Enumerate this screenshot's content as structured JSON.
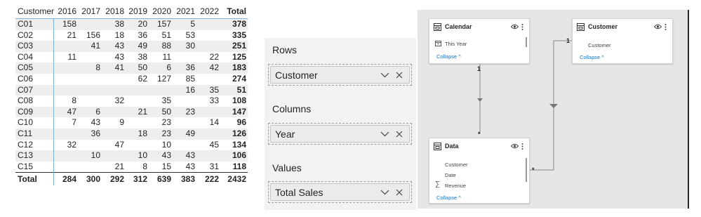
{
  "matrix": {
    "headers": [
      "Customer",
      "2016",
      "2017",
      "2018",
      "2019",
      "2020",
      "2021",
      "2022",
      "Total"
    ],
    "rows": [
      [
        "C01",
        "158",
        "",
        "38",
        "20",
        "157",
        "5",
        "",
        "378"
      ],
      [
        "C02",
        "21",
        "156",
        "18",
        "36",
        "51",
        "53",
        "",
        "335"
      ],
      [
        "C03",
        "",
        "41",
        "43",
        "49",
        "88",
        "30",
        "",
        "251"
      ],
      [
        "C04",
        "11",
        "",
        "43",
        "38",
        "11",
        "",
        "22",
        "125"
      ],
      [
        "C05",
        "",
        "8",
        "41",
        "50",
        "6",
        "36",
        "42",
        "183"
      ],
      [
        "C06",
        "",
        "",
        "",
        "62",
        "127",
        "85",
        "",
        "274"
      ],
      [
        "C07",
        "",
        "",
        "",
        "",
        "",
        "16",
        "35",
        "51"
      ],
      [
        "C08",
        "8",
        "",
        "32",
        "",
        "35",
        "",
        "33",
        "108"
      ],
      [
        "C09",
        "47",
        "6",
        "",
        "21",
        "50",
        "23",
        "",
        "147"
      ],
      [
        "C10",
        "7",
        "43",
        "9",
        "",
        "23",
        "",
        "14",
        "96"
      ],
      [
        "C11",
        "",
        "36",
        "",
        "18",
        "23",
        "49",
        "",
        "126"
      ],
      [
        "C12",
        "32",
        "",
        "47",
        "",
        "10",
        "",
        "45",
        "134"
      ],
      [
        "C13",
        "",
        "10",
        "",
        "10",
        "43",
        "43",
        "",
        "106"
      ],
      [
        "C15",
        "",
        "",
        "21",
        "8",
        "15",
        "43",
        "31",
        "118"
      ]
    ],
    "total_row": [
      "Total",
      "284",
      "300",
      "292",
      "312",
      "639",
      "383",
      "222",
      "2432"
    ]
  },
  "field_wells": {
    "rows_title": "Rows",
    "rows_field": "Customer",
    "columns_title": "Columns",
    "columns_field": "Year",
    "values_title": "Values",
    "values_field": "Total Sales"
  },
  "model": {
    "calendar": {
      "title": "Calendar",
      "fields": [
        "This Year"
      ],
      "collapse": "Collapse ^"
    },
    "customer": {
      "title": "Customer",
      "fields": [
        "Customer"
      ],
      "collapse": "Collapse ^"
    },
    "data": {
      "title": "Data",
      "fields": [
        "Customer",
        "Date",
        "Revenue"
      ],
      "collapse": "Collapse ^"
    },
    "relationships": [
      {
        "from": "Calendar",
        "to": "Data",
        "from_card": "1",
        "to_card": "*"
      },
      {
        "from": "Customer",
        "to": "Data",
        "from_card": "1",
        "to_card": "*"
      }
    ]
  },
  "colors": {
    "matrix_separator": "#7fb0d8",
    "row_band": "#eeeeee",
    "link": "#1a73c8",
    "model_background": "#e6e6e6",
    "wells_background": "#f3f2f1"
  }
}
